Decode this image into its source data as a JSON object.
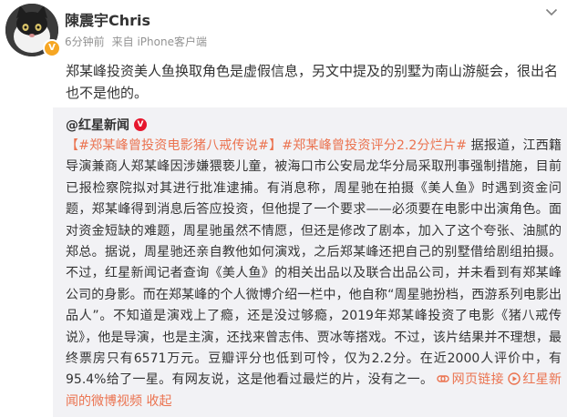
{
  "author": {
    "name": "陳震宇Chris",
    "time": "6分钟前",
    "source": "来自 iPhone客户端"
  },
  "post": {
    "text": "郑某峰投资美人鱼换取角色是虚假信息，另文中提及的别墅为南山游艇会，很出名也不是他的。"
  },
  "repost": {
    "author": "@红星新闻",
    "topic1": "【#郑某峰曾投资电影猪八戒传说#】",
    "topic2": "#郑某峰曾投资评分2.2分烂片#",
    "body": " 据报道，江西籍导演兼商人郑某峰因涉嫌猥亵儿童，被海口市公安局龙华分局采取刑事强制措施，目前已报检察院拟对其进行批准逮捕。有消息称，周星驰在拍摄《美人鱼》时遇到资金问题，郑某峰得到消息后答应投资，但他提了一个要求——必须要在电影中出演角色。面对资金短缺的难题，周星驰虽然不情愿，但还是修改了剧本，加入了这个夸张、油腻的郑总。据说，周星驰还亲自教他如何演戏，之后郑某峰还把自己的别墅借给剧组拍摄。不过，红星新闻记者查询《美人鱼》的相关出品以及联合出品公司，并未看到有郑某峰公司的身影。而在郑某峰的个人微博介绍一栏中，他自称“周星驰扮档，西游系列电影出品人”。不知道是演戏上了瘾，还是没过够瘾，2019年郑某峰投资了电影《猪八戒传说》，他是导演，也是主演，还找来曾志伟、贾冰等搭戏。不过，该片结果并不理想，最终票房只有6571万元。豆瓣评分也低到可怜，仅为2.2分。在近2000人评价中，有95.4%给了一星。有网友说，这是他看过最烂的片，没有之一。",
    "web_link": "网页链接",
    "video_link": "红星新闻的微博视频",
    "collapse": "收起"
  }
}
